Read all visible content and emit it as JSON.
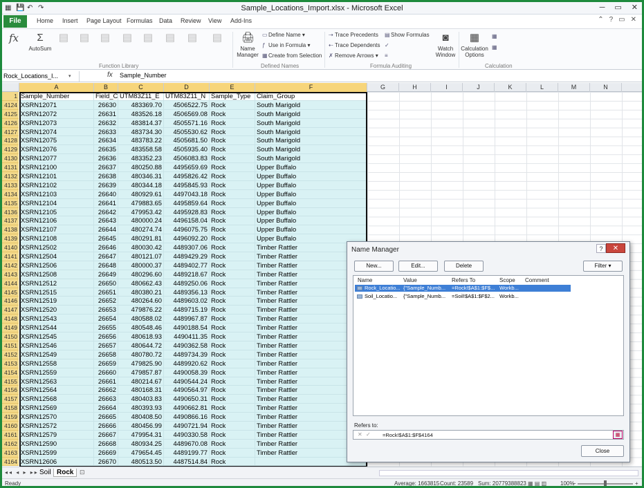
{
  "window": {
    "title": "Sample_Locations_Import.xlsx - Microsoft Excel",
    "controls": [
      "─",
      "▭",
      "✕"
    ]
  },
  "tabs": {
    "file": "File",
    "items": [
      "Home",
      "Insert",
      "Page Layout",
      "Formulas",
      "Data",
      "Review",
      "View",
      "Add-Ins"
    ]
  },
  "ribbon": {
    "groups": [
      "Function Library",
      "Defined Names",
      "Formula Auditing",
      "Calculation"
    ],
    "insert_function": "fx",
    "autosum": "AutoSum",
    "name_manager": "Name\nManager",
    "define_name": "Define Name",
    "use_in_formula": "Use in Formula",
    "create_from_selection": "Create from Selection",
    "trace_precedents": "Trace Precedents",
    "trace_dependents": "Trace Dependents",
    "remove_arrows": "Remove Arrows",
    "show_formulas": "Show Formulas",
    "watch_window": "Watch\nWindow",
    "calculation_options": "Calculation\nOptions"
  },
  "formula_bar": {
    "name_box": "Rock_Locations_I...",
    "fx": "fx",
    "value": "Sample_Number"
  },
  "columns": [
    "A",
    "B",
    "C",
    "D",
    "E",
    "F",
    "G",
    "H",
    "I",
    "J",
    "K",
    "L",
    "M",
    "N"
  ],
  "header_row": {
    "row": "1",
    "cells": [
      "Sample_Number",
      "Field_C",
      "UTM83Z11_E",
      "UTM83Z11_N",
      "Sample_Type",
      "Claim_Group"
    ]
  },
  "rows": [
    [
      "4124",
      "XSRN12071",
      "26630",
      "483369.70",
      "4506522.75",
      "Rock",
      "South Marigold"
    ],
    [
      "4125",
      "XSRN12072",
      "26631",
      "483526.18",
      "4506569.08",
      "Rock",
      "South Marigold"
    ],
    [
      "4126",
      "XSRN12073",
      "26632",
      "483814.37",
      "4505571.16",
      "Rock",
      "South Marigold"
    ],
    [
      "4127",
      "XSRN12074",
      "26633",
      "483734.30",
      "4505530.62",
      "Rock",
      "South Marigold"
    ],
    [
      "4128",
      "XSRN12075",
      "26634",
      "483783.22",
      "4505681.50",
      "Rock",
      "South Marigold"
    ],
    [
      "4129",
      "XSRN12076",
      "26635",
      "483558.58",
      "4505935.40",
      "Rock",
      "South Marigold"
    ],
    [
      "4130",
      "XSRN12077",
      "26636",
      "483352.23",
      "4506083.83",
      "Rock",
      "South Marigold"
    ],
    [
      "4131",
      "XSRN12100",
      "26637",
      "480250.88",
      "4495659.69",
      "Rock",
      "Upper Buffalo"
    ],
    [
      "4132",
      "XSRN12101",
      "26638",
      "480346.31",
      "4495826.42",
      "Rock",
      "Upper Buffalo"
    ],
    [
      "4133",
      "XSRN12102",
      "26639",
      "480344.18",
      "4495845.93",
      "Rock",
      "Upper Buffalo"
    ],
    [
      "4134",
      "XSRN12103",
      "26640",
      "480929.61",
      "4497043.18",
      "Rock",
      "Upper Buffalo"
    ],
    [
      "4135",
      "XSRN12104",
      "26641",
      "479883.65",
      "4495859.64",
      "Rock",
      "Upper Buffalo"
    ],
    [
      "4136",
      "XSRN12105",
      "26642",
      "479953.42",
      "4495928.83",
      "Rock",
      "Upper Buffalo"
    ],
    [
      "4137",
      "XSRN12106",
      "26643",
      "480000.24",
      "4496158.04",
      "Rock",
      "Upper Buffalo"
    ],
    [
      "4138",
      "XSRN12107",
      "26644",
      "480274.74",
      "4496075.75",
      "Rock",
      "Upper Buffalo"
    ],
    [
      "4139",
      "XSRN12108",
      "26645",
      "480291.81",
      "4496092.20",
      "Rock",
      "Upper Buffalo"
    ],
    [
      "4140",
      "XSRN12502",
      "26646",
      "480030.42",
      "4489307.06",
      "Rock",
      "Timber Rattler"
    ],
    [
      "4141",
      "XSRN12504",
      "26647",
      "480121.07",
      "4489429.29",
      "Rock",
      "Timber Rattler"
    ],
    [
      "4142",
      "XSRN12506",
      "26648",
      "480000.37",
      "4489402.77",
      "Rock",
      "Timber Rattler"
    ],
    [
      "4143",
      "XSRN12508",
      "26649",
      "480296.60",
      "4489218.67",
      "Rock",
      "Timber Rattler"
    ],
    [
      "4144",
      "XSRN12512",
      "26650",
      "480662.43",
      "4489250.06",
      "Rock",
      "Timber Rattler"
    ],
    [
      "4145",
      "XSRN12515",
      "26651",
      "480380.21",
      "4489356.13",
      "Rock",
      "Timber Rattler"
    ],
    [
      "4146",
      "XSRN12519",
      "26652",
      "480264.60",
      "4489603.02",
      "Rock",
      "Timber Rattler"
    ],
    [
      "4147",
      "XSRN12520",
      "26653",
      "479876.22",
      "4489715.19",
      "Rock",
      "Timber Rattler"
    ],
    [
      "4148",
      "XSRN12543",
      "26654",
      "480588.02",
      "4489967.87",
      "Rock",
      "Timber Rattler"
    ],
    [
      "4149",
      "XSRN12544",
      "26655",
      "480548.46",
      "4490188.54",
      "Rock",
      "Timber Rattler"
    ],
    [
      "4150",
      "XSRN12545",
      "26656",
      "480618.93",
      "4490411.35",
      "Rock",
      "Timber Rattler"
    ],
    [
      "4151",
      "XSRN12546",
      "26657",
      "480644.72",
      "4490362.58",
      "Rock",
      "Timber Rattler"
    ],
    [
      "4152",
      "XSRN12549",
      "26658",
      "480780.72",
      "4489734.39",
      "Rock",
      "Timber Rattler"
    ],
    [
      "4153",
      "XSRN12558",
      "26659",
      "479825.90",
      "4489920.62",
      "Rock",
      "Timber Rattler"
    ],
    [
      "4154",
      "XSRN12559",
      "26660",
      "479857.87",
      "4490058.39",
      "Rock",
      "Timber Rattler"
    ],
    [
      "4155",
      "XSRN12563",
      "26661",
      "480214.67",
      "4490544.24",
      "Rock",
      "Timber Rattler"
    ],
    [
      "4156",
      "XSRN12564",
      "26662",
      "480168.31",
      "4490564.97",
      "Rock",
      "Timber Rattler"
    ],
    [
      "4157",
      "XSRN12568",
      "26663",
      "480403.83",
      "4490650.31",
      "Rock",
      "Timber Rattler"
    ],
    [
      "4158",
      "XSRN12569",
      "26664",
      "480393.93",
      "4490662.81",
      "Rock",
      "Timber Rattler"
    ],
    [
      "4159",
      "XSRN12570",
      "26665",
      "480408.50",
      "4490866.16",
      "Rock",
      "Timber Rattler"
    ],
    [
      "4160",
      "XSRN12572",
      "26666",
      "480456.99",
      "4490721.94",
      "Rock",
      "Timber Rattler"
    ],
    [
      "4161",
      "XSRN12579",
      "26667",
      "479954.31",
      "4490330.58",
      "Rock",
      "Timber Rattler"
    ],
    [
      "4162",
      "XSRN12590",
      "26668",
      "480934.25",
      "4489670.08",
      "Rock",
      "Timber Rattler"
    ],
    [
      "4163",
      "XSRN12599",
      "26669",
      "479654.45",
      "4489199.77",
      "Rock",
      "Timber Rattler"
    ],
    [
      "4164",
      "XSRN12606",
      "26670",
      "480513.50",
      "4487514.84",
      "Rock",
      ""
    ]
  ],
  "sheets": {
    "nav": "◂◂ ◂ ▸ ▸▸",
    "tabs": [
      "Soil",
      "Rock"
    ],
    "active": "Rock"
  },
  "status": {
    "ready": "Ready",
    "average": "Average: 1663815",
    "count": "Count: 23589",
    "sum": "Sum: 20779388823",
    "zoom": "100%",
    "zoom_minus": "−",
    "zoom_plus": "+"
  },
  "name_manager": {
    "title": "Name Manager",
    "help": "?",
    "close_x": "✕",
    "new_btn": "New...",
    "edit_btn": "Edit...",
    "delete_btn": "Delete",
    "filter_btn": "Filter ▾",
    "headers": [
      "Name",
      "Value",
      "Refers To",
      "Scope",
      "Comment"
    ],
    "names": [
      {
        "name": "Rock_Locatio...",
        "value": "{\"Sample_Numb...",
        "refers": "=Rock!$A$1:$F$...",
        "scope": "Workb...",
        "comment": ""
      },
      {
        "name": "Soil_Locatio...",
        "value": "{\"Sample_Numb...",
        "refers": "=Soil!$A$1:$F$2...",
        "scope": "Workb...",
        "comment": ""
      }
    ],
    "refers_to_label": "Refers to:",
    "refers_to_value": "=Rock!$A$1:$F$4164",
    "cancel_mark": "✕",
    "ok_mark": "✓",
    "close_btn": "Close"
  }
}
